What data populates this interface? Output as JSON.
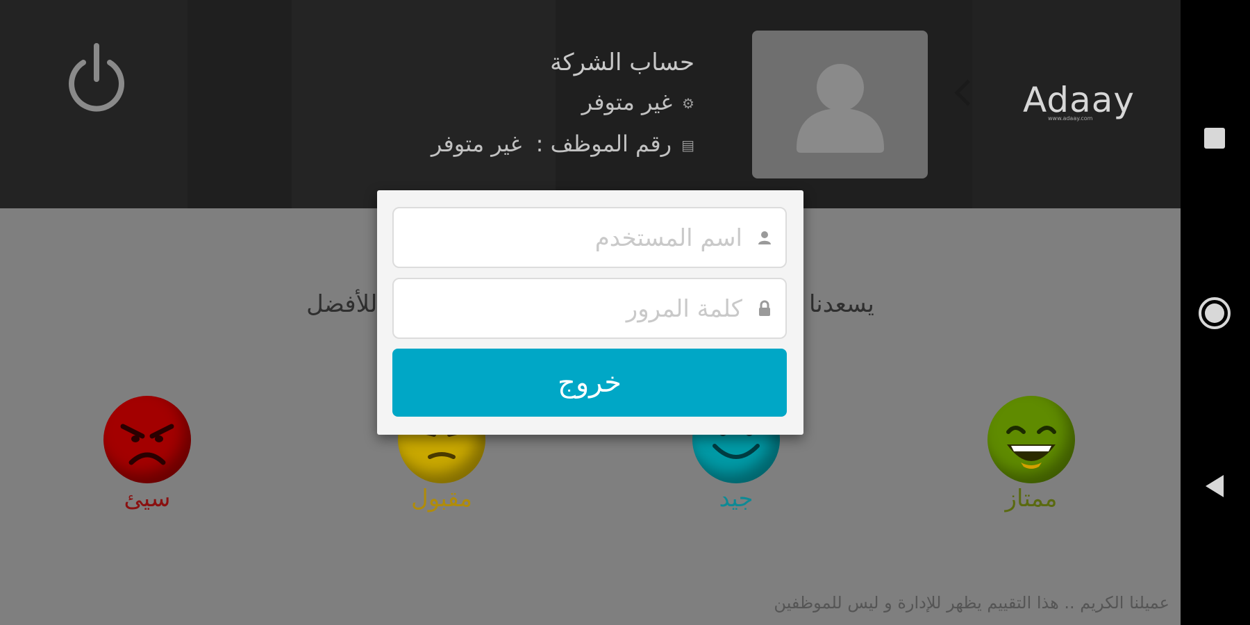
{
  "header": {
    "company_account": "حساب الشركة",
    "status_text": "غير متوفر",
    "employee_label": "رقم الموظف :",
    "employee_value": "غير متوفر",
    "logo_text": "Adaay",
    "logo_url_text": "www.adaay.com"
  },
  "main": {
    "prompt_left": "للأفضل",
    "prompt_right": "يسعدنا",
    "faces": [
      {
        "label": "ممتاز",
        "color": "#5f8b00"
      },
      {
        "label": "جيد",
        "color": "#009aa6"
      },
      {
        "label": "مقبول",
        "color": "#c9a800"
      },
      {
        "label": "سيئ",
        "color": "#a30000"
      }
    ],
    "footer_note": "عميلنا الكريم .. هذا التقييم يظهر للإدارة و ليس للموظفين"
  },
  "dialog": {
    "username_placeholder": "اسم المستخدم",
    "password_placeholder": "كلمة المرور",
    "exit_button": "خروج"
  },
  "icons": {
    "power": "power-icon",
    "gear": "gear-icon",
    "id_card": "id-card-icon",
    "avatar": "user-avatar-icon",
    "user": "user-icon",
    "lock": "lock-icon"
  },
  "colors": {
    "accent": "#00a7c6",
    "header_bg": "#1f1f1f",
    "content_bg": "#7f7f7f"
  }
}
